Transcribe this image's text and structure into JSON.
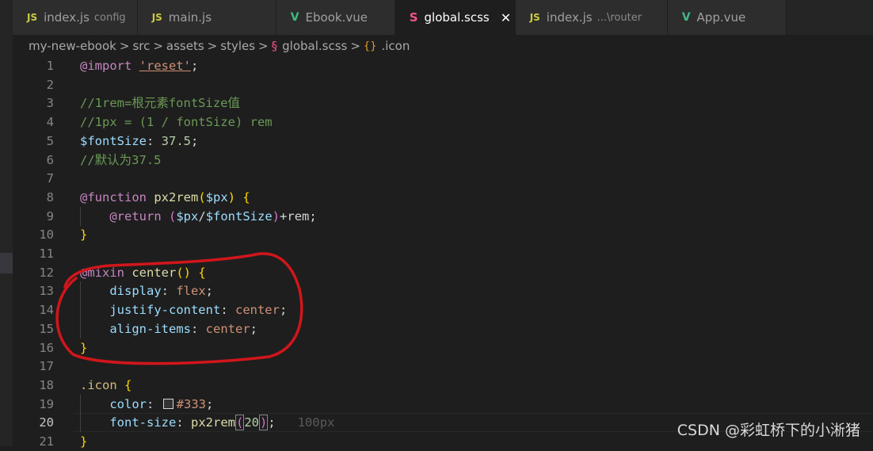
{
  "tabs": [
    {
      "icon": "js-file-icon",
      "badge": "JS",
      "label": "index.js",
      "desc": "config"
    },
    {
      "icon": "js-file-icon",
      "badge": "JS",
      "label": "main.js",
      "desc": ""
    },
    {
      "icon": "vue-file-icon",
      "badge": "V",
      "label": "Ebook.vue",
      "desc": ""
    },
    {
      "icon": "scss-file-icon",
      "badge": "S",
      "label": "global.scss",
      "desc": "",
      "active": true,
      "close": "✕"
    },
    {
      "icon": "js-file-icon",
      "badge": "JS",
      "label": "index.js",
      "desc": "...\\router"
    },
    {
      "icon": "vue-file-icon",
      "badge": "V",
      "label": "App.vue",
      "desc": ""
    }
  ],
  "breadcrumb": [
    "my-new-ebook",
    "src",
    "assets",
    "styles",
    "global.scss",
    ".icon"
  ],
  "lines": [
    {
      "n": "1",
      "code": "@import 'reset';"
    },
    {
      "n": "2",
      "code": ""
    },
    {
      "n": "3",
      "code": "//1rem=根元素fontSize值"
    },
    {
      "n": "4",
      "code": "//1px = (1 / fontSize) rem"
    },
    {
      "n": "5",
      "code": "$fontSize: 37.5;"
    },
    {
      "n": "6",
      "code": "//默认为37.5"
    },
    {
      "n": "7",
      "code": ""
    },
    {
      "n": "8",
      "code": "@function px2rem($px) {"
    },
    {
      "n": "9",
      "code": "    @return ($px/$fontSize)+rem;"
    },
    {
      "n": "10",
      "code": "}"
    },
    {
      "n": "11",
      "code": ""
    },
    {
      "n": "12",
      "code": "@mixin center() {"
    },
    {
      "n": "13",
      "code": "    display: flex;"
    },
    {
      "n": "14",
      "code": "    justify-content: center;"
    },
    {
      "n": "15",
      "code": "    align-items: center;"
    },
    {
      "n": "16",
      "code": "}"
    },
    {
      "n": "17",
      "code": ""
    },
    {
      "n": "18",
      "code": ".icon {"
    },
    {
      "n": "19",
      "code": "    color: #333;"
    },
    {
      "n": "20",
      "code": "    font-size: px2rem(20);",
      "hint": "100px",
      "current": true
    },
    {
      "n": "21",
      "code": "}"
    }
  ],
  "watermark": "CSDN @彩虹桥下的小淅猪",
  "colors": {
    "editor_bg": "#1e1e1e",
    "annotation": "#d0161b",
    "swatch": "#333333"
  }
}
